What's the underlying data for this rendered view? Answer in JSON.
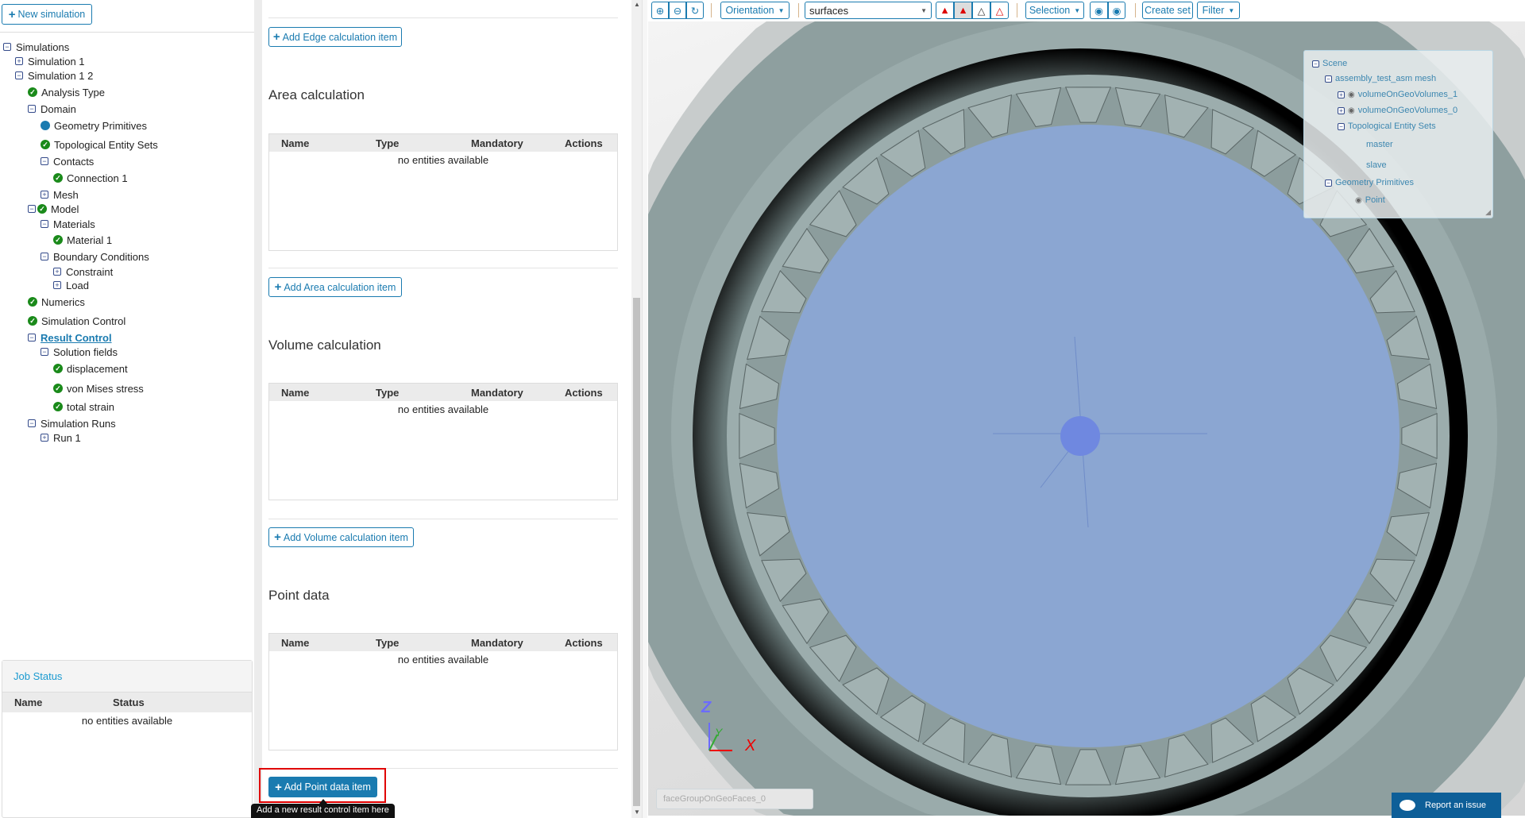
{
  "sidebar": {
    "new_simulation": "New simulation",
    "tree": [
      {
        "label": "Simulations",
        "icon": "minus"
      },
      {
        "label": "Simulation 1",
        "icon": "plus"
      },
      {
        "label": "Simulation 1 2",
        "icon": "minus"
      },
      {
        "label": "Analysis Type",
        "icon": "check"
      },
      {
        "label": "Domain",
        "icon": "minus"
      },
      {
        "label": "Geometry Primitives",
        "icon": "dot"
      },
      {
        "label": "Topological Entity Sets",
        "icon": "check"
      },
      {
        "label": "Contacts",
        "icon": "minus"
      },
      {
        "label": "Connection 1",
        "icon": "check"
      },
      {
        "label": "Mesh",
        "icon": "plus"
      },
      {
        "label": "Model",
        "icon": "minus-check"
      },
      {
        "label": "Materials",
        "icon": "minus"
      },
      {
        "label": "Material 1",
        "icon": "check"
      },
      {
        "label": "Boundary Conditions",
        "icon": "minus"
      },
      {
        "label": "Constraint",
        "icon": "plus"
      },
      {
        "label": "Load",
        "icon": "plus"
      },
      {
        "label": "Numerics",
        "icon": "check"
      },
      {
        "label": "Simulation Control",
        "icon": "check"
      },
      {
        "label": "Result Control",
        "icon": "minus",
        "selected": true
      },
      {
        "label": "Solution fields",
        "icon": "minus"
      },
      {
        "label": "displacement",
        "icon": "check"
      },
      {
        "label": "von Mises stress",
        "icon": "check"
      },
      {
        "label": "total strain",
        "icon": "check"
      },
      {
        "label": "Simulation Runs",
        "icon": "minus"
      },
      {
        "label": "Run 1",
        "icon": "plus"
      }
    ],
    "job_status": {
      "title": "Job Status",
      "columns": [
        "Name",
        "Status"
      ],
      "empty": "no entities available"
    }
  },
  "main": {
    "add_edge": "Add Edge calculation item",
    "columns": [
      "Name",
      "Type",
      "Mandatory",
      "Actions"
    ],
    "empty": "no entities available",
    "sections": [
      {
        "title": "Area calculation",
        "add": "Add Area calculation item"
      },
      {
        "title": "Volume calculation",
        "add": "Add Volume calculation item"
      },
      {
        "title": "Point data",
        "add": "Add Point data item"
      }
    ],
    "tooltip": "Add a new result control item here"
  },
  "toolbar": {
    "orientation": "Orientation",
    "render_mode": "surfaces",
    "selection": "Selection",
    "create_set": "Create set",
    "filter": "Filter"
  },
  "scene": {
    "root": "Scene",
    "mesh": "assembly_test_asm mesh",
    "vol1": "volumeOnGeoVolumes_1",
    "vol0": "volumeOnGeoVolumes_0",
    "tes": "Topological Entity Sets",
    "master": "master",
    "slave": "slave",
    "geo": "Geometry Primitives",
    "point": "Point"
  },
  "viewport": {
    "face_label": "faceGroupOnGeoFaces_0",
    "report": "Report an issue",
    "axes": {
      "x": "X",
      "y": "Y",
      "z": "Z"
    }
  },
  "colors": {
    "accent": "#1a7bb0",
    "check": "#1a8a1a",
    "highlight": "#e00000"
  }
}
